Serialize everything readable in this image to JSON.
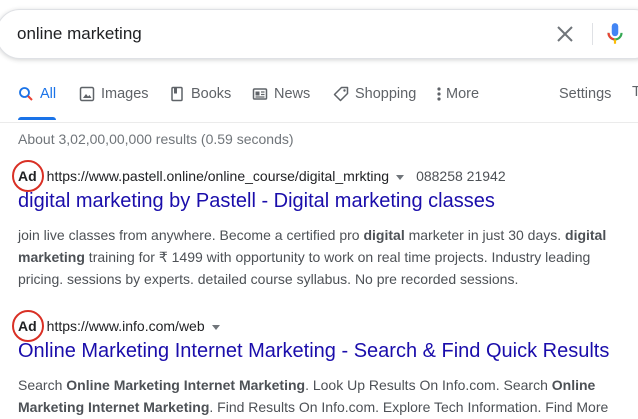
{
  "search": {
    "query": "online marketing"
  },
  "tabs": [
    {
      "label": "All",
      "icon": "search-icon"
    },
    {
      "label": "Images",
      "icon": "image-icon"
    },
    {
      "label": "Books",
      "icon": "book-icon"
    },
    {
      "label": "News",
      "icon": "newspaper-icon"
    },
    {
      "label": "Shopping",
      "icon": "tag-icon"
    },
    {
      "label": "More",
      "icon": "vertical-dots-icon"
    }
  ],
  "settings_label": "Settings",
  "tools_fragment": "T",
  "stats": "About 3,02,00,00,000 results (0.59 seconds)",
  "results": [
    {
      "ad_label": "Ad",
      "url": "https://www.pastell.online/online_course/digital_mrkting",
      "phone": "088258 21942",
      "title": "digital marketing by Pastell - Digital marketing classes",
      "snippet_parts": [
        "join live classes from anywhere. Become a certified pro ",
        "digital",
        " marketer in just 30 days. ",
        "digital marketing",
        " training for ₹ 1499 with opportunity to work on real time projects. Industry leading pricing. sessions by experts. detailed course syllabus. No pre recorded sessions."
      ]
    },
    {
      "ad_label": "Ad",
      "url": "https://www.info.com/web",
      "title": "Online Marketing Internet Marketing - Search & Find Quick Results",
      "snippet_parts": [
        "Search ",
        "Online Marketing Internet Marketing",
        ". Look Up Results On Info.com. Search ",
        "Online Marketing Internet Marketing",
        ". Find Results On Info.com. Explore Tech Information. Find More"
      ]
    }
  ],
  "colors": {
    "link_title": "#1a0dab",
    "active_tab": "#1a73e8",
    "ad_highlight_circle": "#d93025",
    "snippet_text": "#4d5156"
  }
}
